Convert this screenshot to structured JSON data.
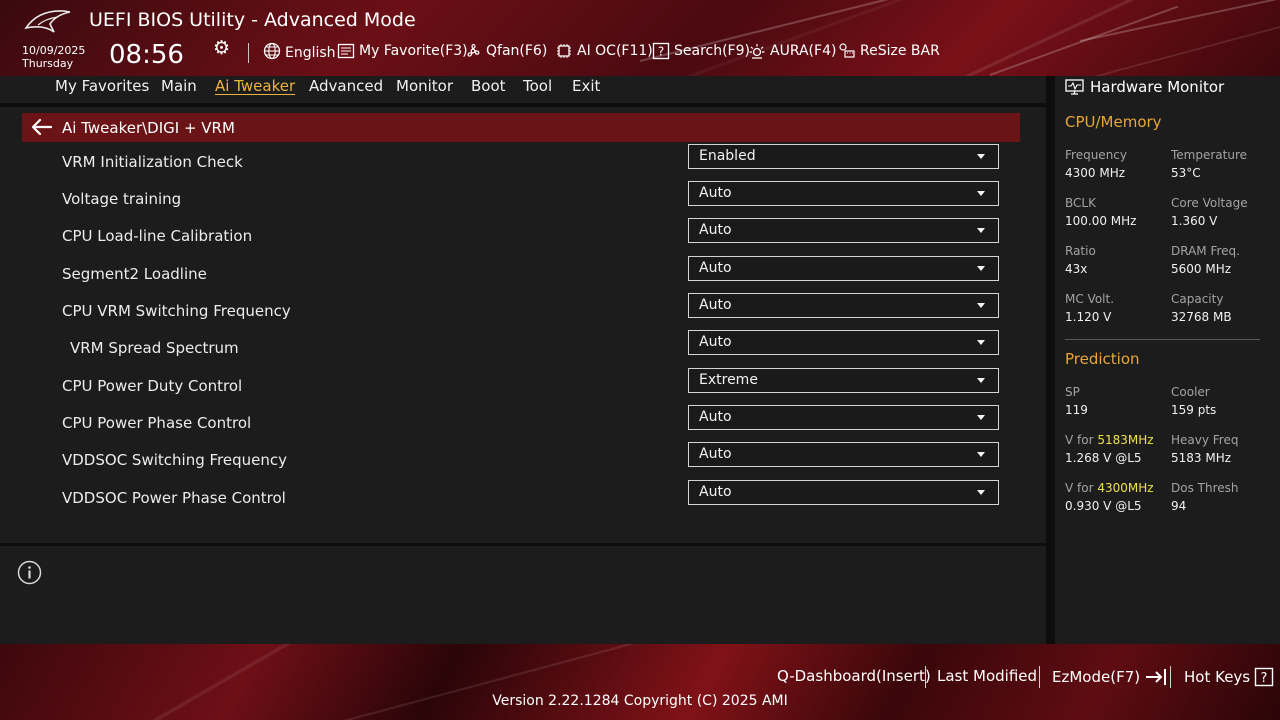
{
  "header": {
    "title": "UEFI BIOS Utility - Advanced Mode",
    "date": "10/09/2025",
    "day": "Thursday",
    "time": "08:56",
    "logo_icon": "rog-logo-icon",
    "settings_icon": "gear-icon",
    "tools": [
      {
        "label": "English",
        "icon": "globe-icon"
      },
      {
        "label": "My Favorite(F3)",
        "icon": "favorite-list-icon"
      },
      {
        "label": "Qfan(F6)",
        "icon": "fan-icon"
      },
      {
        "label": "AI OC(F11)",
        "icon": "ai-chip-icon"
      },
      {
        "label": "Search(F9)",
        "icon": "search-question-icon"
      },
      {
        "label": "AURA(F4)",
        "icon": "aura-light-icon"
      },
      {
        "label": "ReSize BAR",
        "icon": "resize-bar-icon"
      }
    ]
  },
  "nav": {
    "tabs": [
      {
        "label": "My Favorites",
        "active": false
      },
      {
        "label": "Main",
        "active": false
      },
      {
        "label": "Ai Tweaker",
        "active": true
      },
      {
        "label": "Advanced",
        "active": false
      },
      {
        "label": "Monitor",
        "active": false
      },
      {
        "label": "Boot",
        "active": false
      },
      {
        "label": "Tool",
        "active": false
      },
      {
        "label": "Exit",
        "active": false
      }
    ]
  },
  "breadcrumb": {
    "text": "Ai Tweaker\\DIGI + VRM",
    "icon": "back-arrow-icon"
  },
  "settings": [
    {
      "label": "VRM Initialization Check",
      "value": "Enabled"
    },
    {
      "label": "Voltage training",
      "value": "Auto"
    },
    {
      "label": "CPU Load-line Calibration",
      "value": "Auto"
    },
    {
      "label": "Segment2 Loadline",
      "value": "Auto"
    },
    {
      "label": "CPU VRM Switching Frequency",
      "value": "Auto"
    },
    {
      "label": "VRM Spread Spectrum",
      "value": "Auto"
    },
    {
      "label": "CPU Power Duty Control",
      "value": "Extreme"
    },
    {
      "label": "CPU Power Phase Control",
      "value": "Auto"
    },
    {
      "label": "VDDSOC Switching Frequency",
      "value": "Auto"
    },
    {
      "label": "VDDSOC Power Phase Control",
      "value": "Auto"
    }
  ],
  "info": {
    "icon": "info-icon"
  },
  "hw_monitor": {
    "title": "Hardware Monitor",
    "icon": "monitor-icon",
    "cpu_memory": {
      "heading": "CPU/Memory",
      "items": [
        {
          "label": "Frequency",
          "value": "4300 MHz"
        },
        {
          "label": "Temperature",
          "value": "53°C"
        },
        {
          "label": "BCLK",
          "value": "100.00 MHz"
        },
        {
          "label": "Core Voltage",
          "value": "1.360 V"
        },
        {
          "label": "Ratio",
          "value": "43x"
        },
        {
          "label": "DRAM Freq.",
          "value": "5600 MHz"
        },
        {
          "label": "MC Volt.",
          "value": "1.120 V"
        },
        {
          "label": "Capacity",
          "value": "32768 MB"
        }
      ]
    },
    "prediction": {
      "heading": "Prediction",
      "sp_label": "SP",
      "sp_value": "119",
      "cooler_label": "Cooler",
      "cooler_value": "159 pts",
      "v1_prefix": "V for ",
      "v1_freq": "5183MHz",
      "v1_value": "1.268 V @L5",
      "heavy_label": "Heavy Freq",
      "heavy_value": "5183 MHz",
      "v2_prefix": "V for ",
      "v2_freq": "4300MHz",
      "v2_value": "0.930 V @L5",
      "dos_label": "Dos Thresh",
      "dos_value": "94"
    }
  },
  "footer": {
    "q_dashboard": "Q-Dashboard(Insert)",
    "last_modified": "Last Modified",
    "ezmode": "EzMode(F7)",
    "hotkeys": "Hot Keys",
    "version": "Version 2.22.1284 Copyright (C) 2025 AMI"
  },
  "colors": {
    "accent": "#ecb340",
    "breadcrumb_bg": "#6b1418",
    "panel_bg": "#1c1c1c",
    "highlight": "#f0e04a"
  }
}
